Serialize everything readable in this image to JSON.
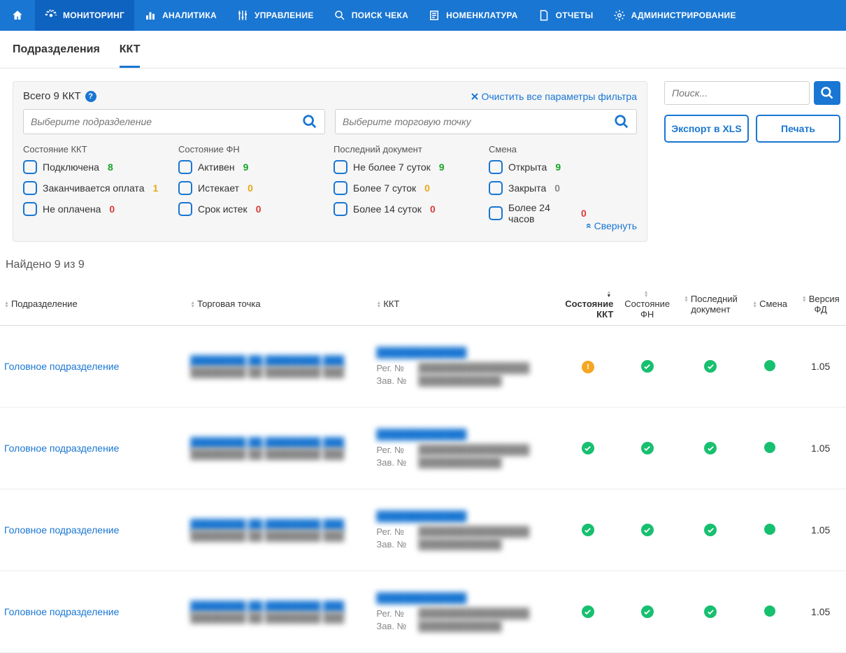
{
  "nav": {
    "items": [
      "МОНИТОРИНГ",
      "АНАЛИТИКА",
      "УПРАВЛЕНИЕ",
      "ПОИСК ЧЕКА",
      "НОМЕНКЛАТУРА",
      "ОТЧЕТЫ",
      "АДМИНИСТРИРОВАНИЕ"
    ],
    "active_index": 0
  },
  "subtabs": {
    "items": [
      "Подразделения",
      "ККТ"
    ],
    "active_index": 1
  },
  "filter": {
    "total_label": "Всего 9 ККТ",
    "clear_label": "Очистить все параметры фильтра",
    "select_department_placeholder": "Выберите подразделение",
    "select_point_placeholder": "Выберите торговую точку",
    "collapse_label": "Свернуть",
    "columns": [
      {
        "title": "Состояние ККТ",
        "items": [
          {
            "label": "Подключена",
            "count": "8",
            "cls": "g"
          },
          {
            "label": "Заканчивается оплата",
            "count": "1",
            "cls": "o"
          },
          {
            "label": "Не оплачена",
            "count": "0",
            "cls": "r"
          }
        ]
      },
      {
        "title": "Состояние ФН",
        "items": [
          {
            "label": "Активен",
            "count": "9",
            "cls": "g"
          },
          {
            "label": "Истекает",
            "count": "0",
            "cls": "o"
          },
          {
            "label": "Срок истек",
            "count": "0",
            "cls": "r"
          }
        ]
      },
      {
        "title": "Последний документ",
        "items": [
          {
            "label": "Не более 7 суток",
            "count": "9",
            "cls": "g"
          },
          {
            "label": "Более 7 суток",
            "count": "0",
            "cls": "o"
          },
          {
            "label": "Более 14 суток",
            "count": "0",
            "cls": "r"
          }
        ]
      },
      {
        "title": "Смена",
        "items": [
          {
            "label": "Открыта",
            "count": "9",
            "cls": "g"
          },
          {
            "label": "Закрыта",
            "count": "0",
            "cls": ""
          },
          {
            "label": "Более 24 часов",
            "count": "0",
            "cls": "r"
          }
        ]
      }
    ]
  },
  "search": {
    "placeholder": "Поиск..."
  },
  "buttons": {
    "export": "Экспорт в XLS",
    "print": "Печать"
  },
  "results": {
    "found_label": "Найдено 9 из 9"
  },
  "table": {
    "headers": [
      "Подразделение",
      "Торговая точка",
      "ККТ",
      "Состояние ККТ",
      "Состояние ФН",
      "Последний документ",
      "Смена",
      "Версия ФД"
    ],
    "reg_label": "Рег. №",
    "zav_label": "Зав. №",
    "rows": [
      {
        "dep": "Головное подразделение",
        "kkt_warn": true,
        "ver": "1.05"
      },
      {
        "dep": "Головное подразделение",
        "kkt_warn": false,
        "ver": "1.05"
      },
      {
        "dep": "Головное подразделение",
        "kkt_warn": false,
        "ver": "1.05"
      },
      {
        "dep": "Головное подразделение",
        "kkt_warn": false,
        "ver": "1.05"
      }
    ]
  }
}
